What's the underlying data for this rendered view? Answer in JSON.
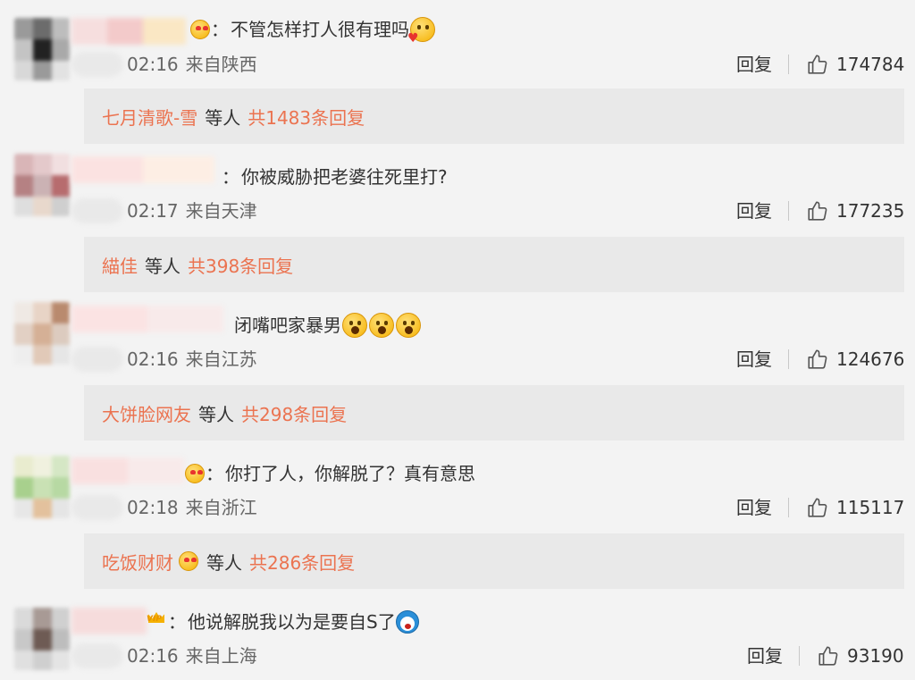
{
  "comments": [
    {
      "text": "不管怎样打人很有理吗",
      "time": "02:16",
      "location": "来自陕西",
      "reply_label": "回复",
      "likes": "174784",
      "reply_summary": {
        "users": "七月清歌-雪",
        "etc": "等人",
        "total": "共1483条回复"
      }
    },
    {
      "text": "你被威胁把老婆往死里打?",
      "time": "02:17",
      "location": "来自天津",
      "reply_label": "回复",
      "likes": "177235",
      "reply_summary": {
        "users": "緢佳",
        "etc": "等人",
        "total": "共398条回复"
      }
    },
    {
      "text": "闭嘴吧家暴男",
      "time": "02:16",
      "location": "来自江苏",
      "reply_label": "回复",
      "likes": "124676",
      "reply_summary": {
        "users": "大饼脸网友",
        "etc": "等人",
        "total": "共298条回复"
      }
    },
    {
      "text": "你打了人，你解脱了？真有意思",
      "time": "02:18",
      "location": "来自浙江",
      "reply_label": "回复",
      "likes": "115117",
      "reply_summary": {
        "users": "吃饭财财",
        "etc": "等人",
        "total": "共286条回复"
      }
    },
    {
      "text": "他说解脱我以为是要自S了",
      "time": "02:16",
      "location": "来自上海",
      "reply_label": "回复",
      "likes": "93190"
    }
  ],
  "colors": {
    "accent": "#eb7350",
    "background": "#f3f3f3",
    "reply_panel": "#e9e9e9"
  },
  "icons": {
    "like": "thumbs-up-icon",
    "emoji": "emoji-icon",
    "vip": "vip-crown-icon"
  }
}
